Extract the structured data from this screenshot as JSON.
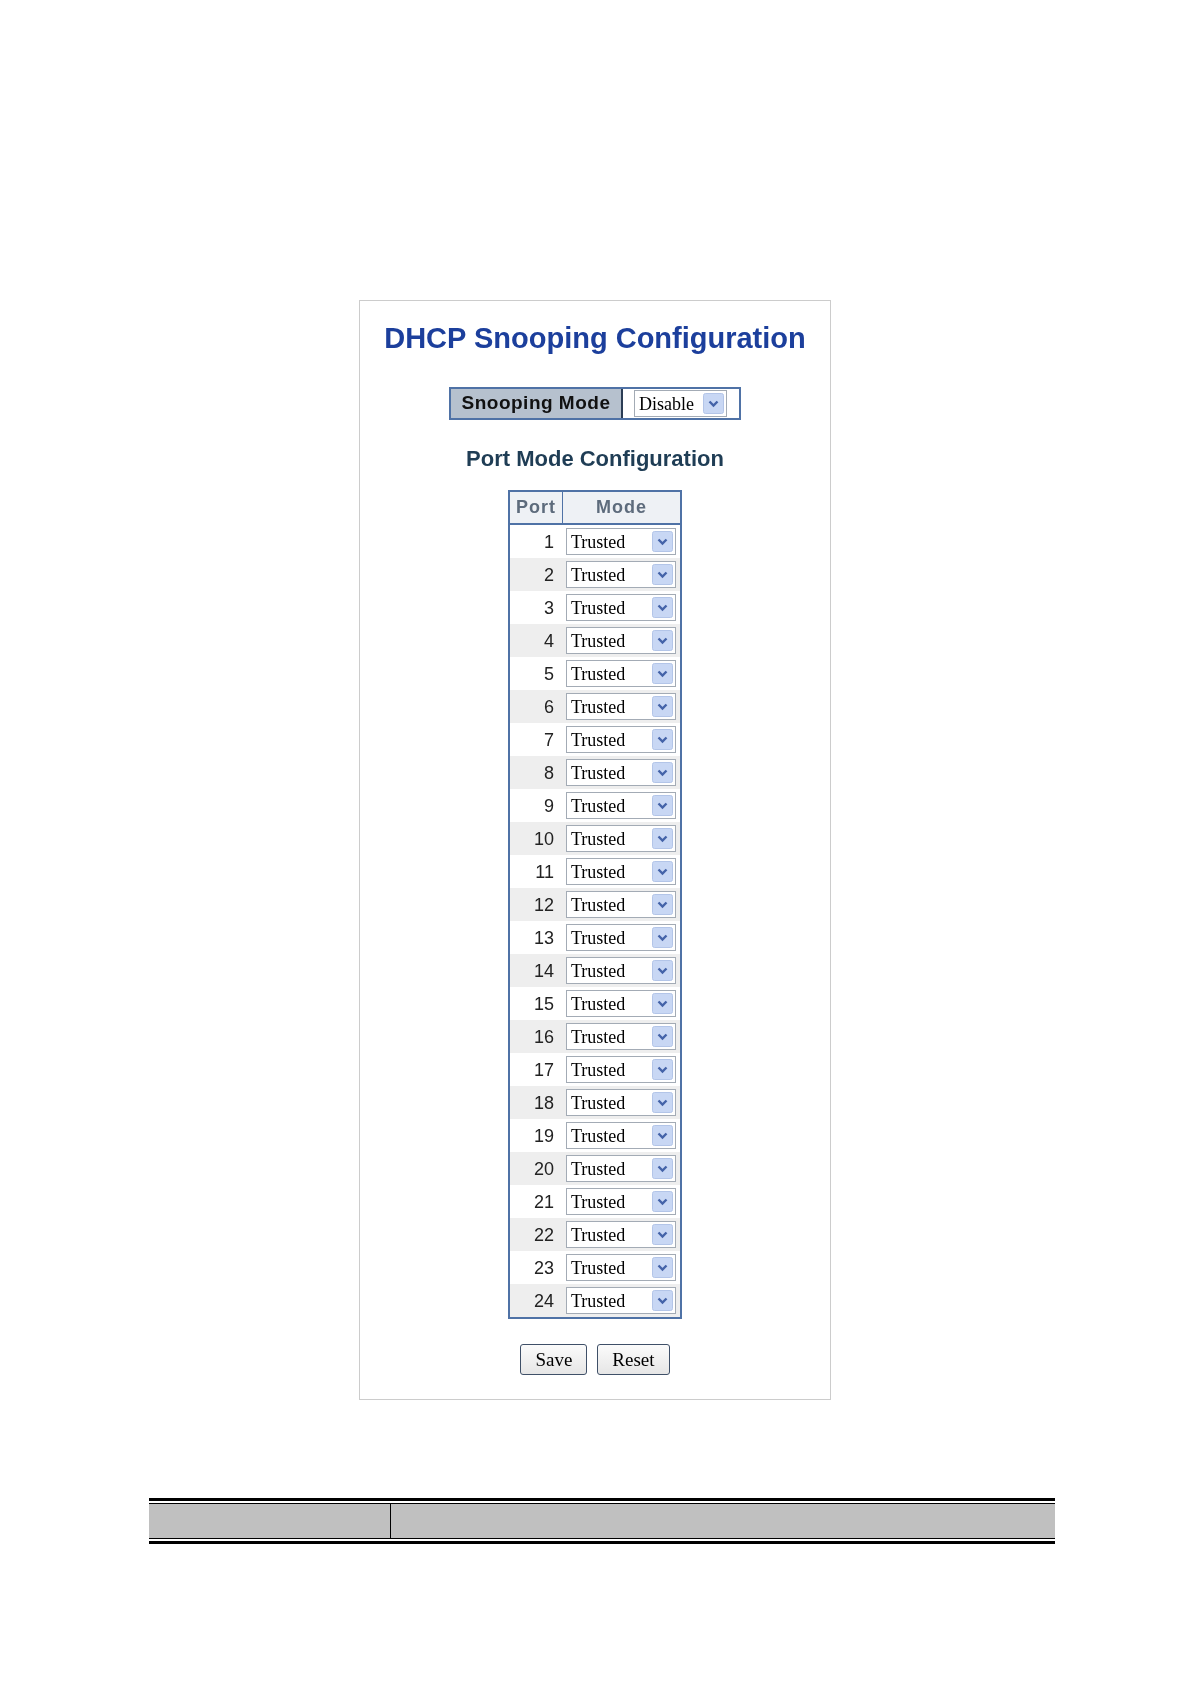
{
  "page": {
    "title": "DHCP Snooping Configuration",
    "snooping_mode": {
      "label": "Snooping Mode",
      "value": "Disable"
    },
    "section_title": "Port Mode Configuration",
    "table": {
      "columns": [
        "Port",
        "Mode"
      ],
      "rows": [
        {
          "port": "1",
          "mode": "Trusted"
        },
        {
          "port": "2",
          "mode": "Trusted"
        },
        {
          "port": "3",
          "mode": "Trusted"
        },
        {
          "port": "4",
          "mode": "Trusted"
        },
        {
          "port": "5",
          "mode": "Trusted"
        },
        {
          "port": "6",
          "mode": "Trusted"
        },
        {
          "port": "7",
          "mode": "Trusted"
        },
        {
          "port": "8",
          "mode": "Trusted"
        },
        {
          "port": "9",
          "mode": "Trusted"
        },
        {
          "port": "10",
          "mode": "Trusted"
        },
        {
          "port": "11",
          "mode": "Trusted"
        },
        {
          "port": "12",
          "mode": "Trusted"
        },
        {
          "port": "13",
          "mode": "Trusted"
        },
        {
          "port": "14",
          "mode": "Trusted"
        },
        {
          "port": "15",
          "mode": "Trusted"
        },
        {
          "port": "16",
          "mode": "Trusted"
        },
        {
          "port": "17",
          "mode": "Trusted"
        },
        {
          "port": "18",
          "mode": "Trusted"
        },
        {
          "port": "19",
          "mode": "Trusted"
        },
        {
          "port": "20",
          "mode": "Trusted"
        },
        {
          "port": "21",
          "mode": "Trusted"
        },
        {
          "port": "22",
          "mode": "Trusted"
        },
        {
          "port": "23",
          "mode": "Trusted"
        },
        {
          "port": "24",
          "mode": "Trusted"
        }
      ]
    },
    "buttons": [
      {
        "label": "Save"
      },
      {
        "label": "Reset"
      }
    ]
  }
}
